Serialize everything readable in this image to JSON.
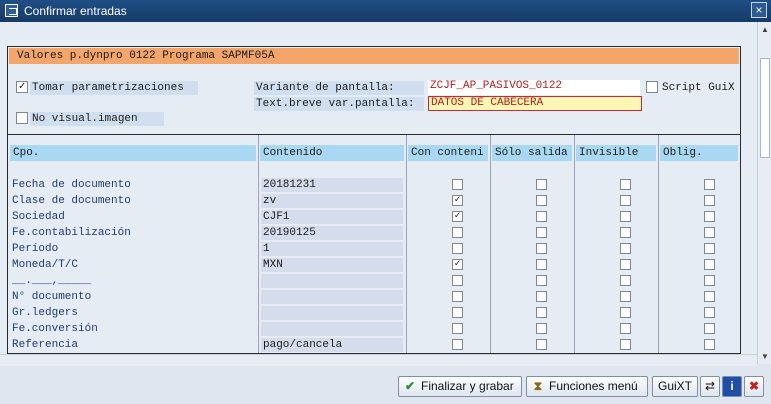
{
  "window": {
    "title": "Confirmar entradas",
    "close_label": "×"
  },
  "banner": "Valores p.dynpro 0122 Programa SAPMF05A",
  "options": {
    "tomar_label": "Tomar parametrizaciones",
    "tomar_checked": "✓",
    "no_visual_label": "No visual.imagen",
    "no_visual_checked": "",
    "variante_label": "Variante de pantalla:",
    "variante_value": "ZCJF_AP_PASIVOS_0122",
    "textbreve_label": "Text.breve var.pantalla:",
    "textbreve_value": "DATOS DE CABECERA",
    "script_label": "Script GuiX",
    "script_checked": ""
  },
  "table": {
    "headers": [
      "Cpo.",
      "Contenido",
      "Con conteni",
      "Sólo salida",
      "Invisible",
      "Oblig."
    ],
    "rows": [
      {
        "cpo": "Fecha de documento",
        "val": "20181231",
        "c1": "",
        "c2": "",
        "c3": "",
        "c4": ""
      },
      {
        "cpo": "Clase de documento",
        "val": "zv",
        "c1": "✓",
        "c2": "",
        "c3": "",
        "c4": ""
      },
      {
        "cpo": "Sociedad",
        "val": "CJF1",
        "c1": "✓",
        "c2": "",
        "c3": "",
        "c4": ""
      },
      {
        "cpo": "Fe.contabilización",
        "val": "20190125",
        "c1": "",
        "c2": "",
        "c3": "",
        "c4": ""
      },
      {
        "cpo": "Período",
        "val": "1",
        "c1": "",
        "c2": "",
        "c3": "",
        "c4": ""
      },
      {
        "cpo": "Moneda/T/C",
        "val": "MXN",
        "c1": "✓",
        "c2": "",
        "c3": "",
        "c4": ""
      },
      {
        "cpo": "__.___,_____",
        "val": "",
        "c1": "",
        "c2": "",
        "c3": "",
        "c4": ""
      },
      {
        "cpo": "N° documento",
        "val": "",
        "c1": "",
        "c2": "",
        "c3": "",
        "c4": ""
      },
      {
        "cpo": "Gr.ledgers",
        "val": "",
        "c1": "",
        "c2": "",
        "c3": "",
        "c4": ""
      },
      {
        "cpo": "Fe.conversión",
        "val": "",
        "c1": "",
        "c2": "",
        "c3": "",
        "c4": ""
      },
      {
        "cpo": "Referencia",
        "val": "pago/cancela",
        "c1": "",
        "c2": "",
        "c3": "",
        "c4": ""
      }
    ]
  },
  "footer": {
    "finalizar_label": "Finalizar y grabar",
    "funciones_label": "Funciones menú",
    "guixt_label": "GuiXT"
  },
  "colors": {
    "banner": "#f4a66a",
    "header": "#a9d9f2",
    "titlebar": "#1f4e86",
    "field_text": "#b3201d"
  }
}
